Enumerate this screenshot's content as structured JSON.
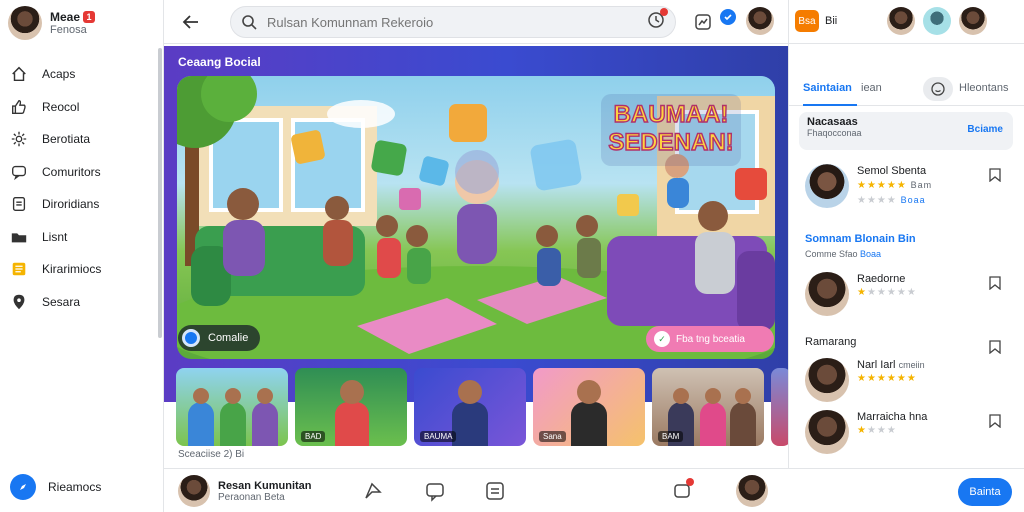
{
  "sidebar": {
    "profile": {
      "name": "Meae",
      "sub": "Fenosa",
      "badge": "1"
    },
    "items": [
      {
        "label": "Acaps",
        "icon": "home-icon"
      },
      {
        "label": "Reocol",
        "icon": "thumb-up-icon"
      },
      {
        "label": "Berotiata",
        "icon": "gear-icon"
      },
      {
        "label": "Comuritors",
        "icon": "chat-icon"
      },
      {
        "label": "Diroridians",
        "icon": "document-icon"
      },
      {
        "label": "Lisnt",
        "icon": "folder-icon"
      },
      {
        "label": "Kirarimiocs",
        "icon": "notes-icon"
      },
      {
        "label": "Sesara",
        "icon": "location-icon"
      }
    ],
    "bottom": {
      "label": "Rieamocs",
      "icon": "compass-icon"
    }
  },
  "topbar": {
    "search_placeholder": "Rulsan Komunnam Rekeroio"
  },
  "right_top": {
    "label": "Bsa",
    "chip": "Bii"
  },
  "hero": {
    "section_title": "Ceaang Bocial",
    "banner_text_1": "BAUMAA!",
    "banner_text_2": "SEDENAN!",
    "chip_label": "Comalie",
    "cta_label": "Fba tng bceatia"
  },
  "thumbnails": {
    "items": [
      {
        "label": ""
      },
      {
        "label": "BAD"
      },
      {
        "label": "BAUMA"
      },
      {
        "label": "Sana"
      },
      {
        "label": "BAM"
      },
      {
        "label": ""
      }
    ],
    "meta": "Sceaciise  2) Bi"
  },
  "bottombar": {
    "name": "Resan Kumunitan",
    "sub": "Peraonan Beta",
    "button": "Bainta"
  },
  "panel": {
    "tab_active": "Saintaian",
    "tab_2": "iean",
    "tab_3": "Hleontans",
    "box": {
      "title": "Nacasaas",
      "sub": "Fhaqocconaa",
      "action": "Bciame"
    },
    "members_top": [
      {
        "name": "Semol Sbenta",
        "meta": "Bam",
        "link": "Boaa",
        "stars": 5
      }
    ],
    "section_1": {
      "title": "Somnam Blonain",
      "tag": "Bin",
      "sub": "Comme Sfao",
      "link": "Boaa"
    },
    "member_mid": {
      "name": "Raedorne",
      "stars": 1
    },
    "section_2": {
      "title": "Ramarang"
    },
    "members_bottom": [
      {
        "name": "Narl Iarl",
        "meta": "cmeiin",
        "stars": 5
      },
      {
        "name": "Marraicha hna",
        "stars": 1
      }
    ]
  },
  "colors": {
    "accent": "#1877f2",
    "hero_bg": "#5b3cc4",
    "cta": "#f07bb3"
  }
}
